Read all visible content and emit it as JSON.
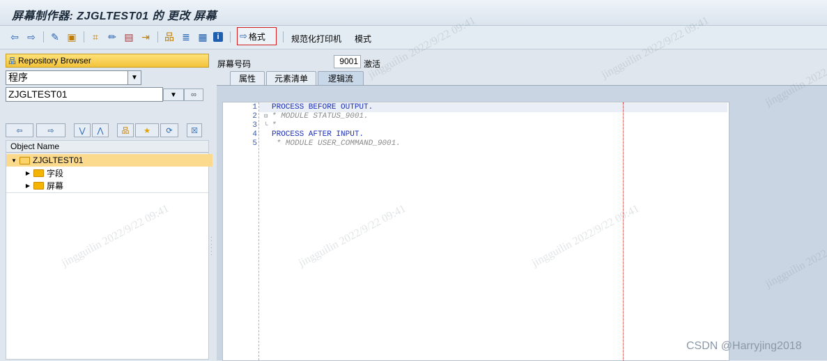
{
  "window": {
    "title": "屏幕制作器: ZJGLTEST01 的 更改 屏幕"
  },
  "toolbar": {
    "format_label": "格式",
    "printer_label": "规范化打印机",
    "mode_label": "模式"
  },
  "left_pane": {
    "header": "Repository Browser",
    "object_type": "程序",
    "object_name": "ZJGLTEST01",
    "tree_header": "Object Name",
    "tree": {
      "root": "ZJGLTEST01",
      "children": [
        "字段",
        "屏幕"
      ]
    }
  },
  "screen": {
    "label": "屏幕号码",
    "number": "9001",
    "status": "激活"
  },
  "tabs": [
    "属性",
    "元素清单",
    "逻辑流"
  ],
  "editor": {
    "lines": [
      {
        "no": "1",
        "text": "PROCESS BEFORE OUTPUT."
      },
      {
        "no": "2",
        "text": "* MODULE STATUS_9001."
      },
      {
        "no": "3",
        "text": "*"
      },
      {
        "no": "4",
        "text": "PROCESS AFTER INPUT."
      },
      {
        "no": "5",
        "text": " * MODULE USER_COMMAND_9001."
      }
    ]
  },
  "watermark": {
    "text": "jingguilin 2022/9/22 09:41"
  },
  "credit": "CSDN @Harryjing2018"
}
